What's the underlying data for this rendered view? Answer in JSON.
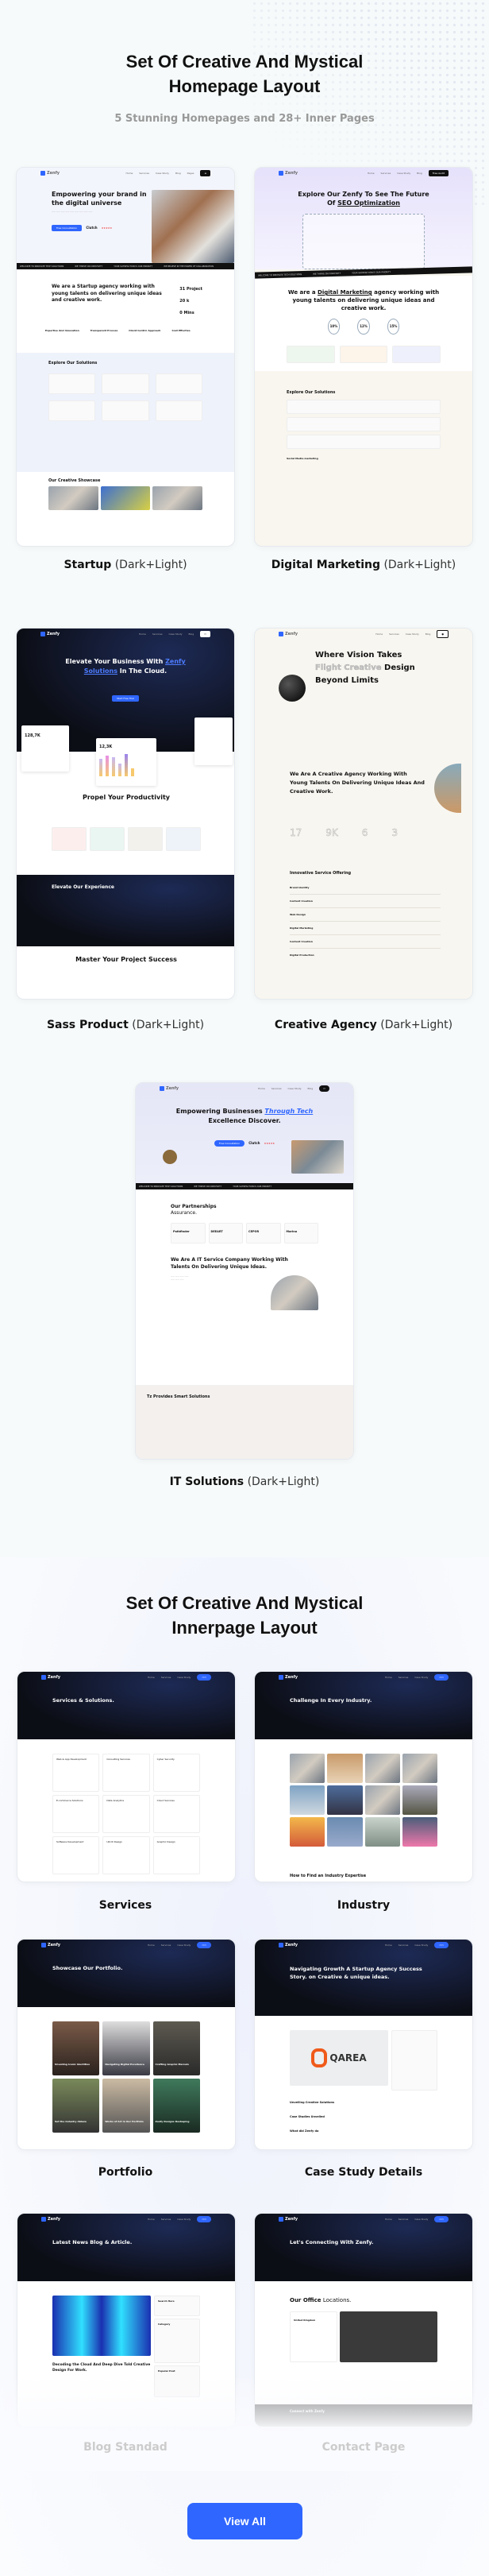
{
  "home_section": {
    "title_line1": "Set Of Creative And Mystical",
    "title_line2": "Homepage Layout",
    "subtitle": "5 Stunning Homepages and 28+ Inner Pages"
  },
  "brand": "Zenfy",
  "nav": [
    "Home",
    "Services",
    "Case Study",
    "Blog",
    "Pages",
    "Contact"
  ],
  "ticker": [
    "WELCOME TO INNOVATE TECH SOLUTIONS",
    "WE THRIVE ON CREATIVITY",
    "YOUR SATISFACTION IS OUR PRIORITY",
    "WE BELIEVE IN THE POWER OF COLLABORATION"
  ],
  "homepages": [
    {
      "name": "Startup",
      "variant": "(Dark+Light)",
      "hero": "Empowering your brand in the digital universe",
      "cta": "Free Consultation",
      "rating_brand": "Clutch",
      "about": "We are a Startup agency working with young talents on delivering unique ideas and creative work.",
      "stats": [
        "31 Project",
        "20 k",
        "0 Mins"
      ],
      "features": [
        "Expertise And Innovation",
        "Transparent Process",
        "Client Centric Approach",
        "Cost Effective"
      ],
      "solutions": "Explore Our Solutions",
      "showcase": "Our Creative Showcase"
    },
    {
      "name": "Digital Marketing",
      "variant": "(Dark+Light)",
      "hero_a": "Explore Our Zenfy To See The Future Of ",
      "hero_b": "SEO Optimization",
      "about_a": "We are a ",
      "about_b": "Digital Marketing",
      "about_c": " agency working with young talents on delivering unique ideas and creative work.",
      "stats": [
        "10%",
        "12%",
        "15%"
      ],
      "solutions": "Explore Our Solutions",
      "item": "Social Media marketing",
      "nav_btn": "Free Audit"
    },
    {
      "name": "Sass Product",
      "variant": "(Dark+Light)",
      "hero_a": "Elevate Your Business With ",
      "hero_b": "Zenfy Solutions",
      "hero_c": " In The Cloud.",
      "cta": "Start Free Trial",
      "stat1": "128,7K",
      "stat2": "12,3K",
      "section": "Propel Your Productivity",
      "section2": "Elevate Our Experience",
      "section3": "Master Your Project Success"
    },
    {
      "name": "Creative Agency",
      "variant": "(Dark+Light)",
      "hero_a": "Where Vision Takes",
      "hero_b": "Flight Creative",
      "hero_c": " Design Beyond Limits",
      "about": "We Are A Creative Agency Working With Young Talents On Delivering Unique Ideas And Creative Work.",
      "stats": [
        "17",
        "9K",
        "6",
        "3"
      ],
      "section": "Innovative Service Offering",
      "services": [
        "Brand Identity",
        "Content Creation",
        "Web Design",
        "Digital Marketing",
        "Content Creation",
        "Digital Production"
      ]
    },
    {
      "name": "IT Solutions",
      "variant": "(Dark+Light)",
      "hero_a": "Empowering Businesses ",
      "hero_b": "Through Tech",
      "hero_c": " Excellence Discover.",
      "cta": "Free Consultation",
      "rating_brand": "Clutch",
      "partners": "Our Partnerships",
      "partners2": "Assurance.",
      "logos": [
        "Pathfinder",
        "DEEART",
        "CEPOR",
        "Marino"
      ],
      "about": "We Are A IT Service Company Working With Talents On Delivering Unique Ideas.",
      "solutions": "Tz Provides Smart Solutions"
    }
  ],
  "inner_section": {
    "title_line1": "Set Of Creative And Mystical",
    "title_line2": "Innerpage Layout"
  },
  "innerpages": [
    {
      "name": "Services",
      "hero": "Services & Solutions.",
      "items": [
        "Web & App Development",
        "Consulting Services",
        "Cyber Security",
        "E-commerce Solutions",
        "Data Analytics",
        "Cloud Services",
        "Software Development",
        "UI/UX Design",
        "Graphic Design"
      ]
    },
    {
      "name": "Industry",
      "hero": "Challenge In Every Industry.",
      "footer": "How to Find an Industry Expertise"
    },
    {
      "name": "Portfolio",
      "hero": "Showcase Our Portfolio.",
      "items": [
        "Unveiling Iconic Identities",
        "Navigating Digital Excellence",
        "Crafting Graphic Marvels",
        "Set the Industry Ablaze",
        "Works of Art In Our Portfolio",
        "Zenfy Designs Reshaping"
      ]
    },
    {
      "name": "Case Study Details",
      "hero": "Navigating Growth A Startup Agency Success Story. on Creative & unique ideas.",
      "logo": "QAREA",
      "h1": "Unveiling Creative Solutions",
      "h2": "Case Studies Unveiled",
      "h3": "What did Zenfy do"
    },
    {
      "name": "Blog Standad",
      "hero": "Latest News Blog & Article.",
      "post": "Decoding the Cloud And Deep Dive Told Creative Design For Work.",
      "sidebar": [
        "Search Here",
        "Category",
        "Popular Post"
      ]
    },
    {
      "name": "Contact Page",
      "hero": "Let's Connecting With Zenfy.",
      "office_a": "Our Office ",
      "office_b": "Locations.",
      "location": "United Kingdom",
      "banner": "Connect with Zenfy"
    }
  ],
  "view_all": "View All",
  "colors": {
    "accent": "#2f66ff",
    "text": "#111111",
    "muted": "#999999"
  }
}
